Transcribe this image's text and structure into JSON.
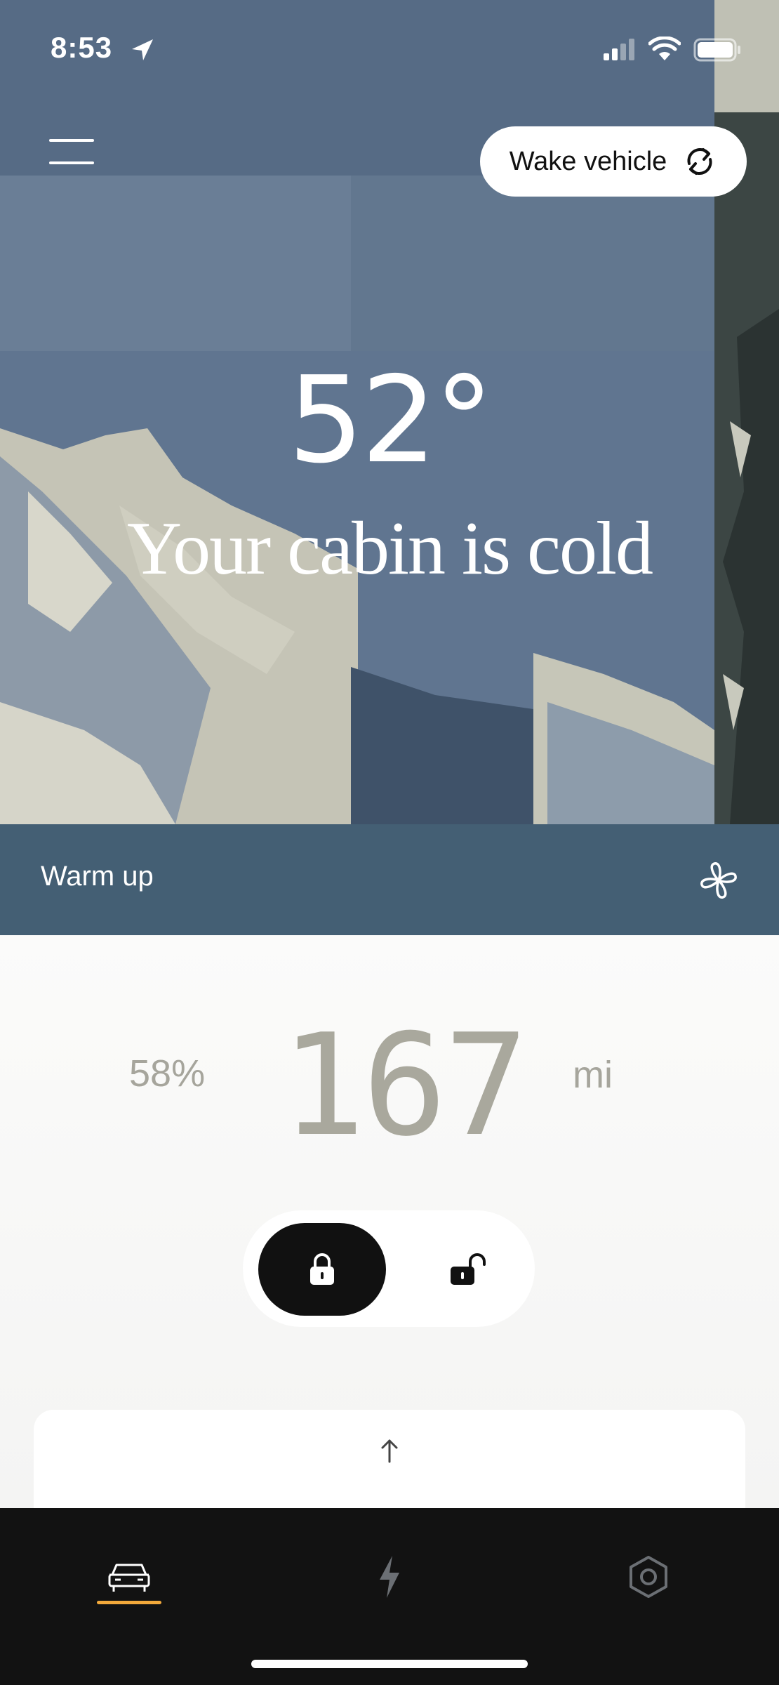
{
  "status_bar": {
    "time": "8:53"
  },
  "header": {
    "wake_label": "Wake vehicle"
  },
  "cabin": {
    "temperature": "52°",
    "message": "Your cabin is cold"
  },
  "warmup": {
    "label": "Warm up"
  },
  "range": {
    "battery_percent": "58%",
    "miles": "167",
    "unit": "mi"
  },
  "lock": {
    "state": "locked"
  },
  "tabs": [
    {
      "icon": "car-icon",
      "active": true
    },
    {
      "icon": "bolt-icon",
      "active": false
    },
    {
      "icon": "hexagon-settings-icon",
      "active": false
    }
  ],
  "colors": {
    "hero_blue": "#5d7189",
    "warmup_bar": "#445f74",
    "active_tab": "#f2a93b",
    "range_text": "#a9a89d"
  }
}
